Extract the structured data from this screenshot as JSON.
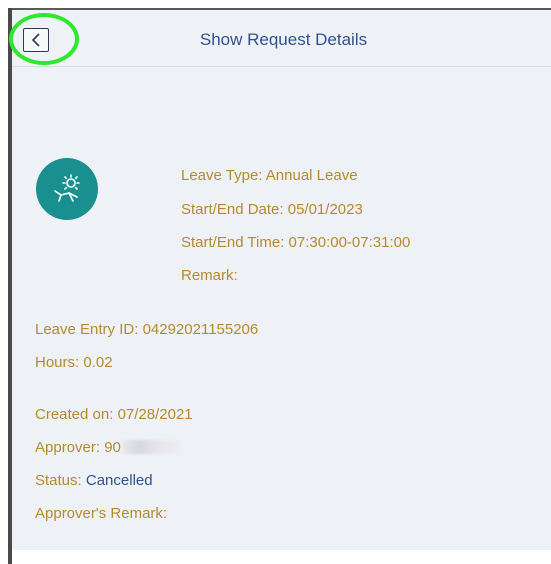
{
  "header": {
    "title": "Show Request Details",
    "back_icon": "chevron-left-icon"
  },
  "leave": {
    "icon": "sunbathing-icon",
    "type_label": "Leave Type:",
    "type_value": "Annual Leave",
    "date_label": "Start/End Date:",
    "date_value": "05/01/2023",
    "time_label": "Start/End Time:",
    "time_value": "07:30:00-07:31:00",
    "remark_label": "Remark:"
  },
  "entry": {
    "id_label": "Leave Entry ID:",
    "id_value": "04292021155206",
    "hours_label": "Hours:",
    "hours_value": "0.02"
  },
  "meta": {
    "created_label": "Created on:",
    "created_value": "07/28/2021",
    "approver_label": "Approver:",
    "approver_value": "90",
    "status_label": "Status:",
    "status_value": "Cancelled",
    "approver_remark_label": "Approver's Remark:"
  },
  "colors": {
    "title": "#32518c",
    "label": "#b58a2c",
    "avatar": "#1a8f8f",
    "highlight": "#2ee82e",
    "panel": "#eef2f6"
  }
}
